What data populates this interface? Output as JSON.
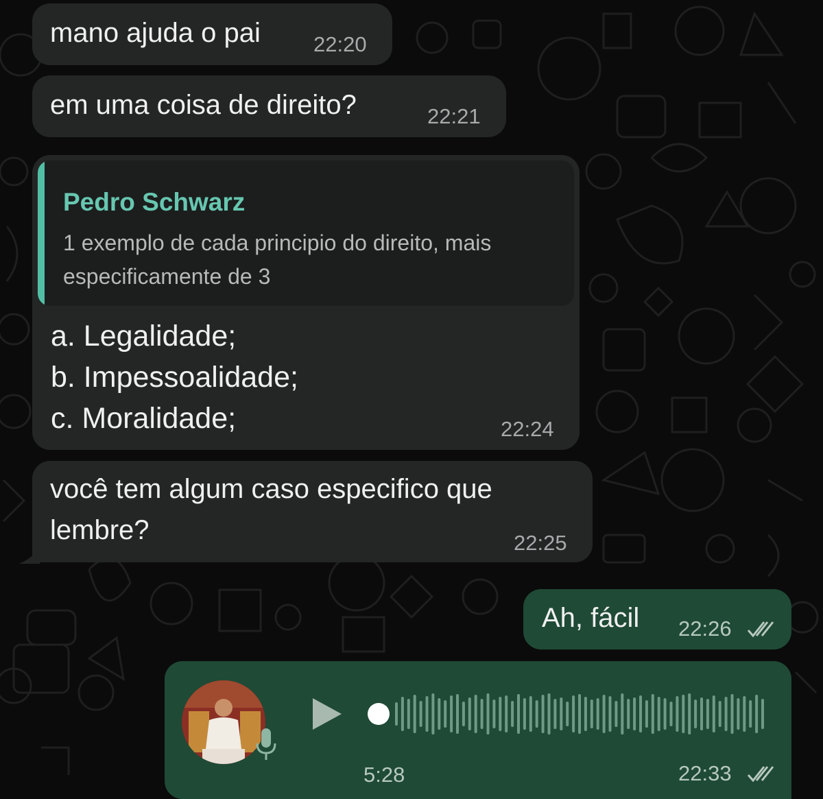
{
  "messages": [
    {
      "text": "mano ajuda o pai",
      "time": "22:20"
    },
    {
      "text": "em uma coisa de direito?",
      "time": "22:21"
    },
    {
      "quote_author": "Pedro Schwarz",
      "quote_text": "1 exemplo de cada principio do direito, mais especificamente de 3",
      "list": [
        "a. Legalidade;",
        "b. Impessoalidade;",
        "c. Moralidade;"
      ],
      "time": "22:24"
    },
    {
      "text_line1": "você tem algum caso especifico que",
      "text_line2": "lembre?",
      "time": "22:25"
    },
    {
      "text": "Ah, fácil",
      "time": "22:26",
      "status": "double-check-icon"
    },
    {
      "type": "voice",
      "duration": "5:28",
      "time": "22:33",
      "status": "double-check-icon",
      "progress": 0
    }
  ],
  "colors": {
    "incoming_bubble": "#242626",
    "outgoing_bubble": "#1f4a36",
    "quote_accent": "#52bfa5",
    "quote_name": "#67c7b0"
  }
}
